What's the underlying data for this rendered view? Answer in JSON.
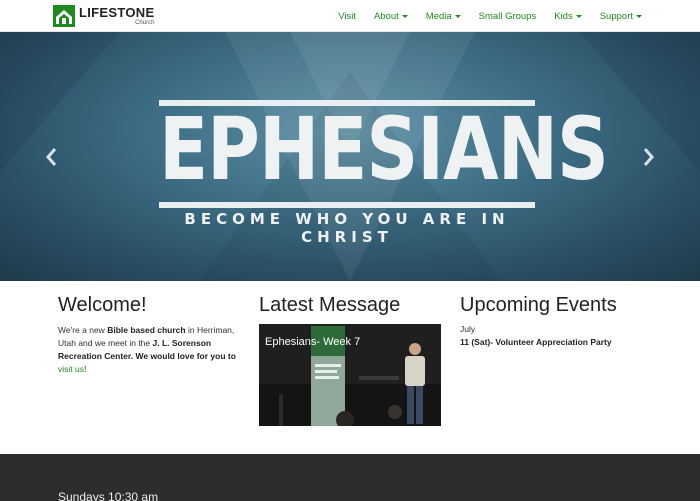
{
  "header": {
    "logo_name": "LIFESTONE",
    "logo_sub": "Church",
    "nav": [
      {
        "label": "Visit",
        "dropdown": false
      },
      {
        "label": "About",
        "dropdown": true
      },
      {
        "label": "Media",
        "dropdown": true
      },
      {
        "label": "Small Groups",
        "dropdown": false
      },
      {
        "label": "Kids",
        "dropdown": true
      },
      {
        "label": "Support",
        "dropdown": true
      }
    ]
  },
  "hero": {
    "title": "EPHESIANS",
    "subtitle": "BECOME WHO YOU ARE IN CHRIST"
  },
  "welcome": {
    "heading": "Welcome!",
    "text_1": "We're a new ",
    "bold_1": "Bible based church",
    "text_2": " in Herriman, Utah and we meet in the ",
    "bold_2": "J. L. Sorenson Recreation Center.",
    "bold_3": " We would love for you to",
    "link": "visit us",
    "text_3": "!"
  },
  "latest_message": {
    "heading": "Latest Message",
    "video_title": "Ephesians- Week 7"
  },
  "events": {
    "heading": "Upcoming Events",
    "month": "July",
    "items": [
      "11 (Sat)- Volunteer Appreciation Party"
    ]
  },
  "footer": {
    "text": "Sundays 10:30 am"
  },
  "colors": {
    "brand_green": "#1f8a1f",
    "footer_bg": "#2d2d2d",
    "hero_blue": "#3d6e86"
  }
}
